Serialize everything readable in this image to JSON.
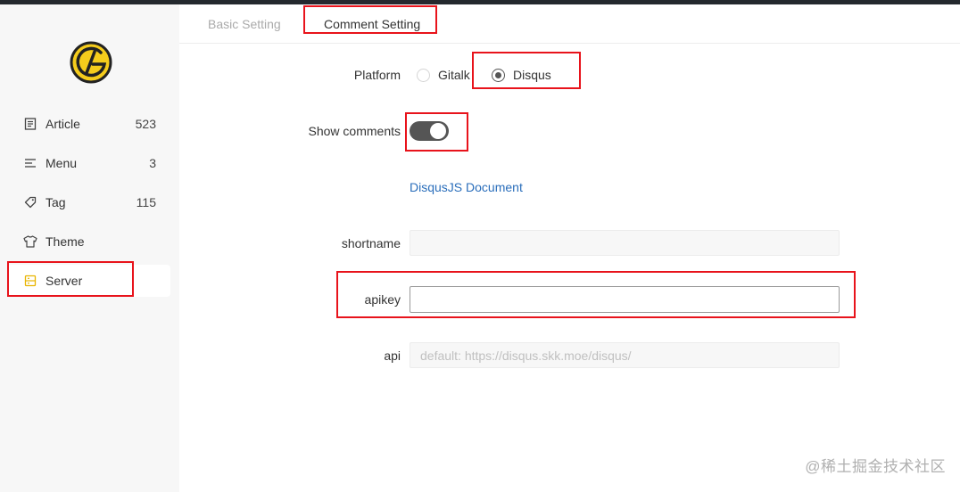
{
  "tabs": {
    "basic": "Basic Setting",
    "comment": "Comment Setting"
  },
  "sidebar": {
    "items": [
      {
        "icon": "article-icon",
        "label": "Article",
        "count": "523"
      },
      {
        "icon": "menu-icon",
        "label": "Menu",
        "count": "3"
      },
      {
        "icon": "tag-icon",
        "label": "Tag",
        "count": "115"
      },
      {
        "icon": "theme-icon",
        "label": "Theme",
        "count": ""
      },
      {
        "icon": "server-icon",
        "label": "Server",
        "count": ""
      }
    ],
    "active": "Server"
  },
  "form": {
    "platform_label": "Platform",
    "platform_options": [
      "Gitalk",
      "Disqus"
    ],
    "platform_selected": "Disqus",
    "show_comments_label": "Show comments",
    "show_comments_on": true,
    "doc_link": "DisqusJS Document",
    "shortname_label": "shortname",
    "shortname_value": "",
    "apikey_label": "apikey",
    "apikey_value": "",
    "api_label": "api",
    "api_placeholder": "default: https://disqus.skk.moe/disqus/"
  },
  "watermark": "@稀土掘金技术社区",
  "colors": {
    "highlight": "#e8131b",
    "logo_yellow": "#f5cc1c",
    "link": "#2a6ebb",
    "server_icon": "#e8b400"
  }
}
